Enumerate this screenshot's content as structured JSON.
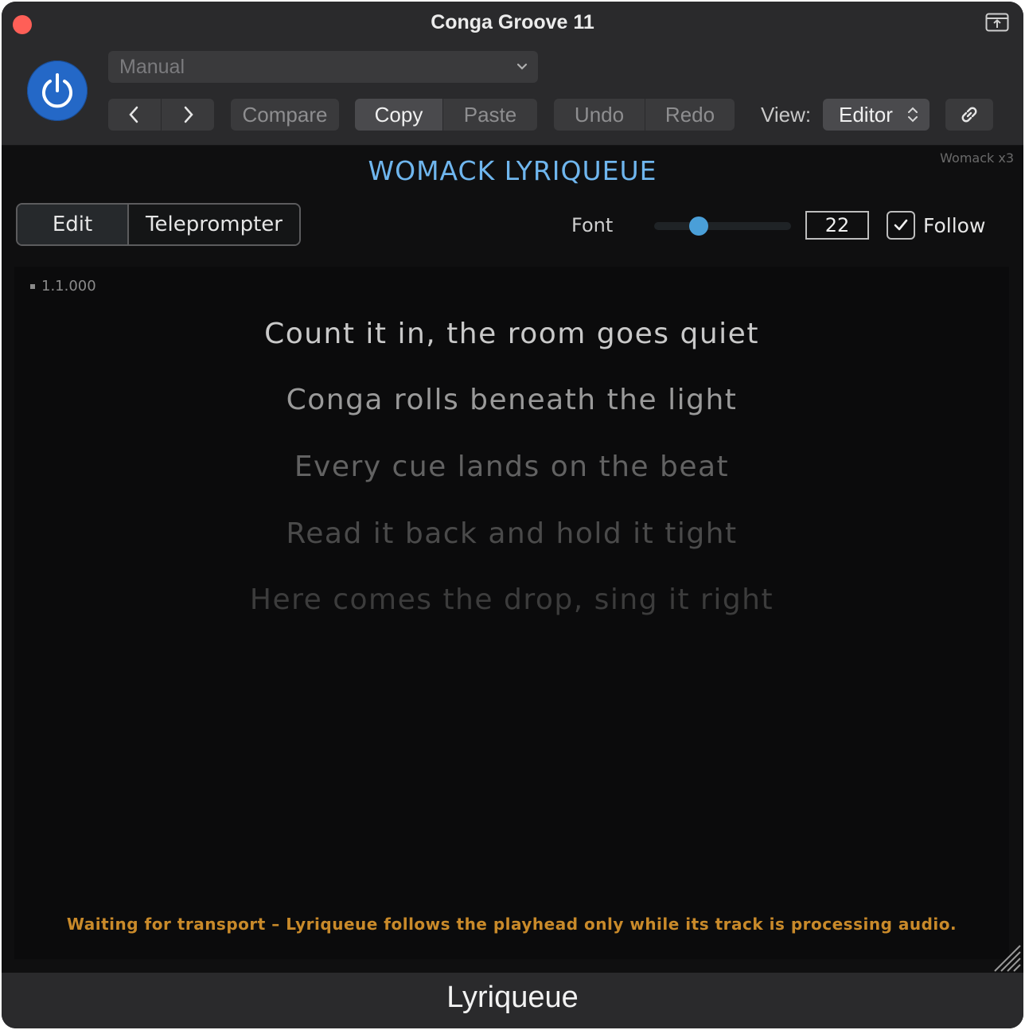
{
  "window": {
    "title": "Conga Groove 11"
  },
  "header": {
    "preset": "Manual",
    "compare_label": "Compare",
    "copy_label": "Copy",
    "paste_label": "Paste",
    "undo_label": "Undo",
    "redo_label": "Redo",
    "view_label": "View:",
    "view_value": "Editor"
  },
  "plugin": {
    "brand": "WOMACK LYRIQUEUE",
    "instance": "Womack x3",
    "tabs": {
      "edit": "Edit",
      "teleprompter": "Teleprompter",
      "active": "Edit"
    },
    "font_label": "Font",
    "font_size": "22",
    "font_slider_fraction": 0.3,
    "follow_label": "Follow",
    "follow_checked": true,
    "position": "1.1.000",
    "lyrics": [
      {
        "text": "Count it in, the room goes quiet",
        "color": "#c9c9c9"
      },
      {
        "text": "Conga rolls beneath the light",
        "color": "#9a9a9a"
      },
      {
        "text": "Every cue lands on the beat",
        "color": "#626262"
      },
      {
        "text": "Read it back and hold it tight",
        "color": "#4a4a4a"
      },
      {
        "text": "Here comes the drop, sing it right",
        "color": "#3c3c3c"
      }
    ],
    "status": "Waiting for transport – Lyriqueue follows the playhead only while its track is processing audio."
  },
  "footer": {
    "label": "Lyriqueue"
  },
  "colors": {
    "accent": "#6fb6ee",
    "power": "#2468c7",
    "status": "#c98a2a",
    "close": "#ff5f57"
  }
}
